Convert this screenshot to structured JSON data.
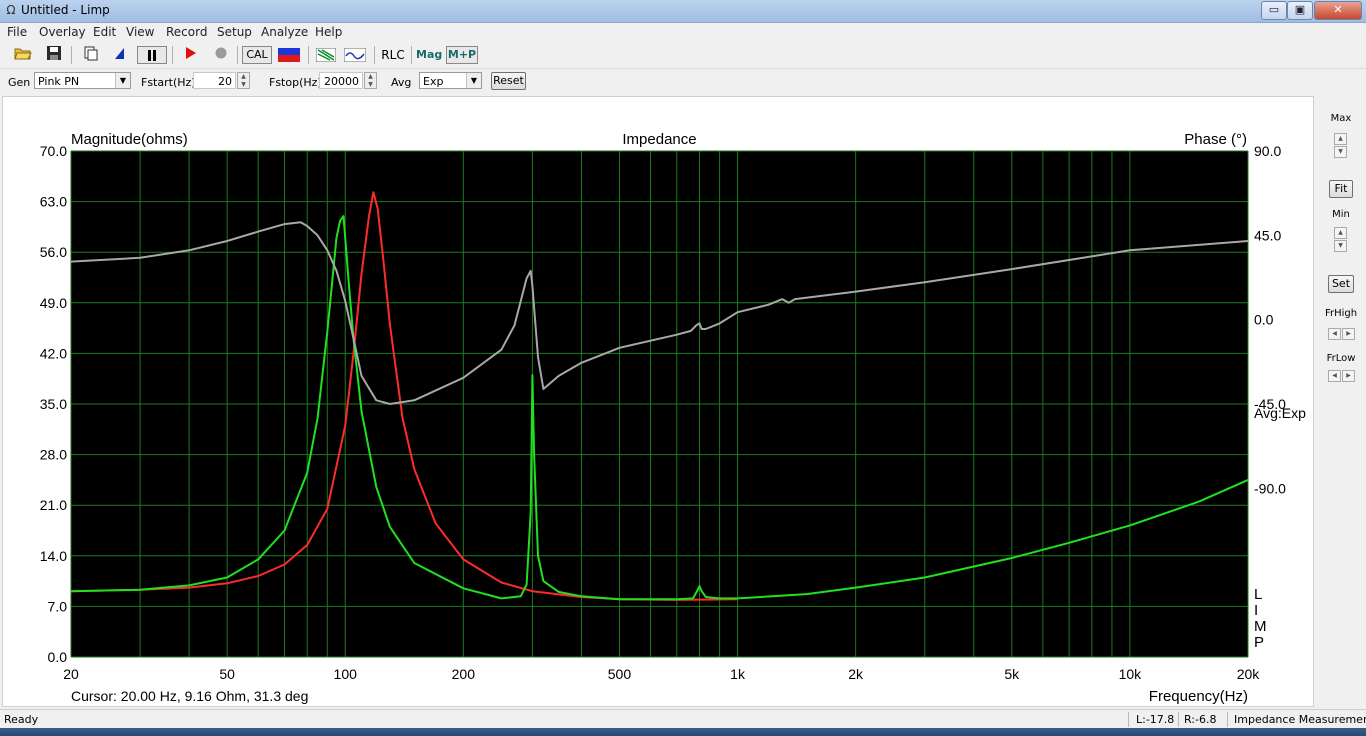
{
  "window": {
    "title": "Untitled - Limp",
    "icon": "omega-icon",
    "min_label": "▭",
    "max_label": "▣",
    "close_label": "✕"
  },
  "menu": [
    "File",
    "Overlay",
    "Edit",
    "View",
    "Record",
    "Setup",
    "Analyze",
    "Help"
  ],
  "toolbar": {
    "cal": "CAL",
    "rlc": "RLC",
    "mag": "Mag",
    "mp": "M+P",
    "record_color": "#e01010",
    "stop_color": "#9a9a9a"
  },
  "gen": {
    "gen_label": "Gen",
    "gen_value": "Pink PN",
    "fstart_label": "Fstart(Hz)",
    "fstart_value": "20",
    "fstop_label": "Fstop(Hz)",
    "fstop_value": "20000",
    "avg_label": "Avg",
    "avg_value": "Exp",
    "reset_label": "Reset"
  },
  "right_panel": {
    "max": "Max",
    "fit": "Fit",
    "min": "Min",
    "set": "Set",
    "frhigh": "FrHigh",
    "frlow": "FrLow"
  },
  "status": {
    "ready": "Ready",
    "l": "L:-17.8",
    "r": "R:-6.8",
    "mode": "Impedance Measuremen"
  },
  "chart_data": {
    "type": "line",
    "title": "Impedance",
    "ylabel": "Magnitude(ohms)",
    "y2label": "Phase (°)",
    "xlabel": "Frequency(Hz)",
    "x_scale": "log",
    "xlim": [
      20,
      20000
    ],
    "ylim": [
      0,
      70
    ],
    "y2lim": [
      -180,
      90
    ],
    "x_ticks": [
      20,
      50,
      100,
      200,
      500,
      1000,
      2000,
      5000,
      10000,
      20000
    ],
    "x_tick_labels": [
      "20",
      "50",
      "100",
      "200",
      "500",
      "1k",
      "2k",
      "5k",
      "10k",
      "20k"
    ],
    "y_tick_labels": [
      "70.0",
      "63.0",
      "56.0",
      "49.0",
      "42.0",
      "35.0",
      "28.0",
      "21.0",
      "14.0",
      "7.0",
      "0.0"
    ],
    "y2_tick_labels": [
      "90.0",
      "45.0",
      "0.0",
      "-45.0",
      "-90.0"
    ],
    "annotation_avg": "Avg:Exp",
    "annotation_limp": [
      "L",
      "I",
      "M",
      "P"
    ],
    "cursor_readout": "Cursor: 20.00 Hz, 9.16 Ohm, 31.3 deg",
    "grid": true,
    "background": "#000000",
    "grid_color": "#1c7a1c",
    "series": [
      {
        "color": "#ff2a2a",
        "x": [
          20,
          30,
          40,
          50,
          60,
          70,
          80,
          90,
          100,
          105,
          110,
          115,
          118,
          121,
          125,
          130,
          140,
          150,
          170,
          200,
          250,
          300,
          400,
          500,
          700,
          1000
        ],
        "y": [
          9.1,
          9.3,
          9.6,
          10.2,
          11.2,
          12.8,
          15.5,
          20.5,
          32,
          42,
          53,
          61,
          64.3,
          62,
          55,
          46,
          33,
          26,
          18.5,
          13.5,
          10.3,
          9.1,
          8.3,
          8.0,
          7.9,
          8.0
        ]
      },
      {
        "color": "#20e020",
        "x": [
          20,
          30,
          40,
          50,
          60,
          70,
          80,
          85,
          90,
          95,
          97,
          99,
          100,
          102,
          105,
          110,
          120,
          130,
          150,
          200,
          250,
          280,
          290,
          297,
          300,
          303,
          310,
          320,
          350,
          400,
          500,
          700,
          770,
          790,
          800,
          810,
          830,
          900,
          1000,
          1500,
          2000,
          3000,
          5000,
          7000,
          10000,
          15000,
          20000
        ],
        "y": [
          9.1,
          9.3,
          9.9,
          11,
          13.5,
          17.5,
          25.5,
          33,
          45,
          58,
          60.3,
          61,
          58,
          52,
          44,
          34,
          23.5,
          18,
          13,
          9.5,
          8.1,
          8.4,
          10,
          20,
          39,
          28,
          14,
          10.5,
          9,
          8.4,
          8.0,
          8.0,
          8.1,
          9.2,
          9.8,
          9.1,
          8.3,
          8.1,
          8.1,
          8.7,
          9.6,
          11,
          13.7,
          15.8,
          18.2,
          21.5,
          24.5
        ]
      },
      {
        "color": "#a8a8a8",
        "x": [
          20,
          30,
          40,
          50,
          60,
          70,
          77,
          80,
          85,
          90,
          95,
          100,
          105,
          110,
          120,
          130,
          150,
          200,
          250,
          270,
          290,
          297,
          300,
          310,
          320,
          350,
          400,
          500,
          700,
          760,
          785,
          800,
          810,
          830,
          900,
          1000,
          1200,
          1300,
          1350,
          1400,
          2000,
          3000,
          5000,
          10000,
          20000
        ],
        "y2": [
          31,
          33,
          37,
          42,
          47,
          51,
          52,
          50,
          45,
          37,
          26,
          10,
          -10,
          -30,
          -43,
          -45,
          -43,
          -31,
          -16,
          -3,
          22,
          26,
          18,
          -20,
          -37,
          -30,
          -23,
          -15,
          -8,
          -6,
          -3,
          -2,
          -5,
          -5,
          -2,
          4,
          8,
          11,
          9,
          11,
          15,
          20,
          27,
          37,
          42
        ]
      }
    ]
  }
}
